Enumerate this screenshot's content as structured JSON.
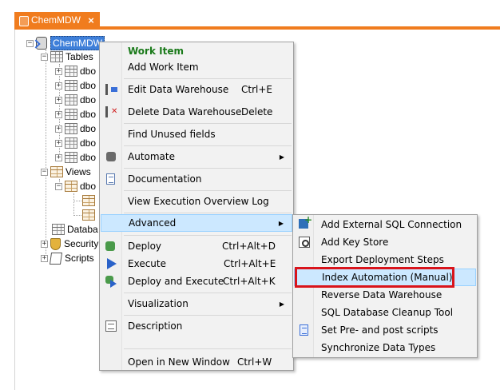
{
  "tab": {
    "title": "ChemMDW",
    "close": "×"
  },
  "tree": {
    "root": "ChemMDW",
    "tables": "Tables",
    "table_items": [
      "dbo",
      "dbo",
      "dbo",
      "dbo",
      "dbo",
      "dbo",
      "dbo"
    ],
    "views": "Views",
    "view_items": [
      "dbo"
    ],
    "databases": "Databa",
    "security": "Security",
    "scripts": "Scripts",
    "expander_minus": "−",
    "expander_plus": "+"
  },
  "context_menu": {
    "items": [
      {
        "label": "Work Item",
        "shortcut": ""
      },
      {
        "label": "Add Work Item",
        "shortcut": ""
      },
      {
        "label": "Edit Data Warehouse",
        "shortcut": "Ctrl+E"
      },
      {
        "label": "Delete Data Warehouse",
        "shortcut": "Delete"
      },
      {
        "label": "Find Unused fields",
        "shortcut": ""
      },
      {
        "label": "Automate",
        "shortcut": ""
      },
      {
        "label": "Documentation",
        "shortcut": ""
      },
      {
        "label": "View Execution Overview Log",
        "shortcut": ""
      },
      {
        "label": "Advanced",
        "shortcut": ""
      },
      {
        "label": "Deploy",
        "shortcut": "Ctrl+Alt+D"
      },
      {
        "label": "Execute",
        "shortcut": "Ctrl+Alt+E"
      },
      {
        "label": "Deploy and Execute",
        "shortcut": "Ctrl+Alt+K"
      },
      {
        "label": "Visualization",
        "shortcut": ""
      },
      {
        "label": "Description",
        "shortcut": ""
      },
      {
        "label": "Open in New Window",
        "shortcut": "Ctrl+W"
      }
    ],
    "submenu_arrow": "▶"
  },
  "advanced_submenu": {
    "items": [
      "Add External SQL Connection",
      "Add Key Store",
      "Export Deployment Steps",
      "Index Automation (Manual)",
      "Reverse Data Warehouse",
      "SQL Database Cleanup Tool",
      "Set Pre- and post scripts",
      "Synchronize Data Types"
    ]
  },
  "colors": {
    "tab_accent": "#f07c1e",
    "selection": "#cce8ff",
    "highlight_box": "#d9141b",
    "work_item": "#1a7a1a"
  }
}
